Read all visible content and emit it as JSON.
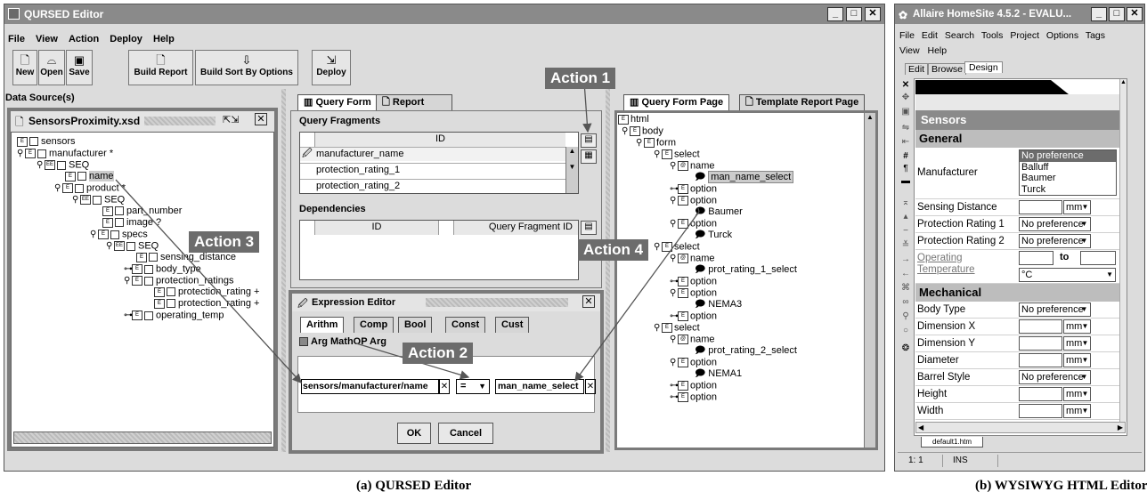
{
  "qursed": {
    "title": "QURSED Editor",
    "menu": [
      "File",
      "View",
      "Action",
      "Deploy",
      "Help"
    ],
    "toolbar": {
      "new": "New",
      "open": "Open",
      "save": "Save",
      "build_report": "Build Report",
      "build_sort": "Build Sort By Options",
      "deploy": "Deploy"
    },
    "data_sources": {
      "label": "Data Source(s)",
      "file": "SensorsProximity.xsd",
      "tree": {
        "sensors": "sensors",
        "manufacturer": "manufacturer *",
        "seq1": "SEQ",
        "name": "name",
        "product": "product *",
        "seq2": "SEQ",
        "part_number": "part_number",
        "image": "image ?",
        "specs": "specs",
        "seq3": "SEQ",
        "sensing_distance": "sensing_distance",
        "body_type": "body_type",
        "protection_ratings": "protection_ratings",
        "protection_rating_a": "protection_rating +",
        "protection_rating_b": "protection_rating +",
        "operating_temp": "operating_temp"
      }
    },
    "middle": {
      "tabs": [
        "Query Form",
        "Report"
      ],
      "query_fragments": {
        "label": "Query Fragments",
        "header": "ID",
        "rows": [
          "manufacturer_name",
          "protection_rating_1",
          "protection_rating_2"
        ]
      },
      "dependencies": {
        "label": "Dependencies",
        "headers": [
          "ID",
          "Query Fragment ID"
        ]
      }
    },
    "expression_editor": {
      "title": "Expression Editor",
      "tabs": [
        "Arithm",
        "Comp",
        "Bool",
        "Const",
        "Cust"
      ],
      "arg_label": "Arg MathOP Arg",
      "left_arg": "sensors/manufacturer/name",
      "operator": "=",
      "right_arg": "man_name_select",
      "ok": "OK",
      "cancel": "Cancel"
    },
    "right": {
      "tabs": [
        "Query Form Page",
        "Template Report Page"
      ],
      "tree": {
        "html": "html",
        "body": "body",
        "form": "form",
        "select1": "select",
        "name1": "name",
        "man_name_select": "man_name_select",
        "option1": "option",
        "option2": "option",
        "baumer": "Baumer",
        "option3": "option",
        "turck": "Turck",
        "select2": "select",
        "name2": "name",
        "prot_rating_1_select": "prot_rating_1_select",
        "option4": "option",
        "option5": "option",
        "nema3": "NEMA3",
        "option6": "option",
        "select3": "select",
        "name3": "name",
        "prot_rating_2_select": "prot_rating_2_select",
        "option7": "option",
        "nema1": "NEMA1",
        "option8": "option",
        "option9": "option"
      }
    },
    "callouts": [
      "Action 1",
      "Action 2",
      "Action 3",
      "Action 4"
    ]
  },
  "homesite": {
    "title": "Allaire HomeSite 4.5.2 - EVALU...",
    "menu1": [
      "File",
      "Edit",
      "Search",
      "Tools",
      "Project",
      "Options",
      "Tags"
    ],
    "menu2": [
      "View",
      "Help"
    ],
    "tabs": [
      "Edit",
      "Browse",
      "Design"
    ],
    "form": {
      "heading": "Sensors",
      "general": "General",
      "manufacturer_label": "Manufacturer",
      "manufacturer_options": [
        "No preference",
        "Balluff",
        "Baumer",
        "Turck"
      ],
      "sensing_distance": "Sensing Distance",
      "protection_rating_1": "Protection Rating 1",
      "protection_rating_2": "Protection Rating 2",
      "operating_temperature": "Operating Temperature",
      "to": "to",
      "deg_c": "°C",
      "mechanical": "Mechanical",
      "body_type": "Body Type",
      "dimension_x": "Dimension X",
      "dimension_y": "Dimension Y",
      "diameter": "Diameter",
      "barrel_style": "Barrel Style",
      "height": "Height",
      "width": "Width",
      "no_pref": "No preference",
      "mm": "mm"
    },
    "file_tab": "default1.htm",
    "status": {
      "pos": "1: 1",
      "mode": "INS"
    }
  },
  "captions": {
    "a": "(a) QURSED Editor",
    "b": "(b) WYSIWYG HTML Editor"
  }
}
